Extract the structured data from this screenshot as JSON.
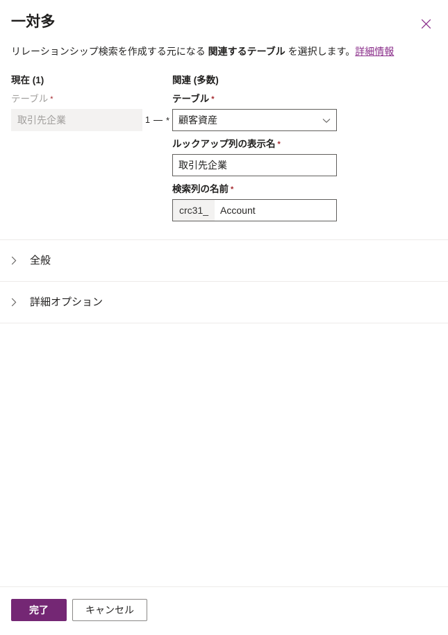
{
  "dialog": {
    "title": "一対多",
    "close_icon": "close-icon",
    "description": {
      "prefix": "リレーションシップ検索を作成する元になる ",
      "emphasis": "関連するテーブル",
      "suffix": " を選択します。",
      "link_label": "詳細情報"
    }
  },
  "current_column": {
    "heading": "現在 (1)",
    "table_field": {
      "label": "テーブル",
      "required_marker": "*",
      "value": "取引先企業",
      "disabled": true
    }
  },
  "cardinality": {
    "left": "1",
    "connector": "—",
    "right": "*"
  },
  "related_column": {
    "heading": "関連 (多数)",
    "table_field": {
      "label": "テーブル",
      "required_marker": "*",
      "value": "顧客資産",
      "chevron_icon": "chevron-down-icon"
    },
    "lookup_display_name_field": {
      "label": "ルックアップ列の表示名",
      "required_marker": "*",
      "value": "取引先企業"
    },
    "lookup_schema_name_field": {
      "label": "検索列の名前",
      "required_marker": "*",
      "prefix": "crc31_",
      "value": "Account"
    }
  },
  "sections": [
    {
      "label": "全般",
      "chevron_icon": "chevron-right-icon",
      "expanded": false
    },
    {
      "label": "詳細オプション",
      "chevron_icon": "chevron-right-icon",
      "expanded": false
    }
  ],
  "footer": {
    "primary_label": "完了",
    "secondary_label": "キャンセル"
  },
  "colors": {
    "accent": "#742774",
    "link": "#8a2d8a",
    "required": "#a4262c",
    "border": "#605e5c",
    "disabled_bg": "#f3f2f1",
    "divider": "#edebe9"
  }
}
